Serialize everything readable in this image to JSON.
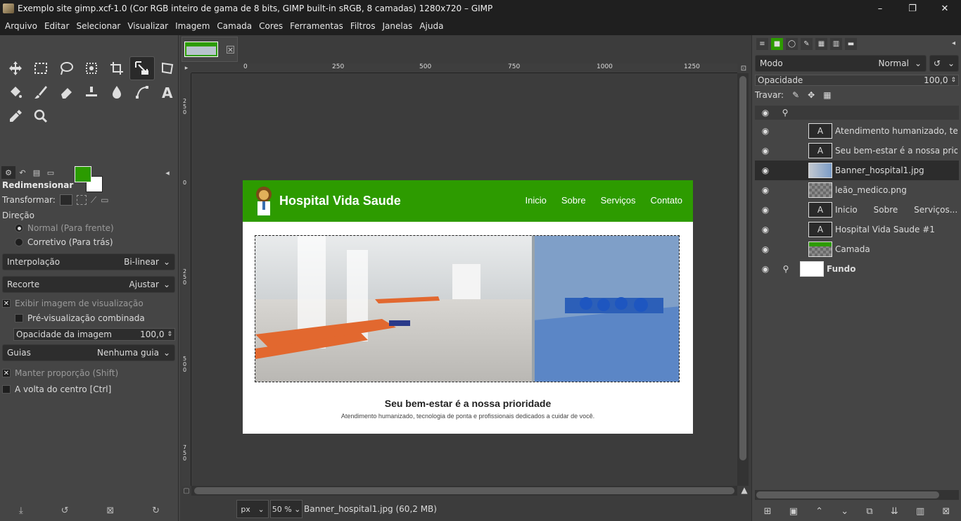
{
  "window": {
    "title": "Exemplo site gimp.xcf-1.0 (Cor RGB inteiro de gama de 8 bits, GIMP built-in sRGB, 8 camadas) 1280x720 – GIMP",
    "minimize": "–",
    "maximize": "❐",
    "close": "✕"
  },
  "menu": [
    "Arquivo",
    "Editar",
    "Selecionar",
    "Visualizar",
    "Imagem",
    "Camada",
    "Cores",
    "Ferramentas",
    "Filtros",
    "Janelas",
    "Ajuda"
  ],
  "colors": {
    "foreground": "#2b9b00",
    "background": "#ffffff",
    "accent_green": "#2d9b00"
  },
  "tool_options": {
    "title": "Redimensionar",
    "transform_label": "Transformar:",
    "direction_label": "Direção",
    "direction_normal": "Normal (Para frente)",
    "direction_corrective": "Corretivo (Para trás)",
    "interpolation_label": "Interpolação",
    "interpolation_value": "Bi-linear",
    "clipping_label": "Recorte",
    "clipping_value": "Ajustar",
    "show_preview": "Exibir imagem de visualização",
    "composited_preview": "Pré-visualização combinada",
    "image_opacity_label": "Opacidade da imagem",
    "image_opacity_value": "100,0",
    "guides_label": "Guias",
    "guides_value": "Nenhuma guia",
    "keep_aspect": "Manter proporção (Shift)",
    "around_center": "A volta do centro [Ctrl]"
  },
  "rulers": {
    "h_ticks": [
      "0",
      "250",
      "500",
      "750",
      "1000",
      "1250"
    ],
    "v_ticks": [
      "250",
      "0",
      "250",
      "500",
      "750"
    ]
  },
  "image": {
    "brand": "Hospital Vida Saude",
    "nav": [
      "Inicio",
      "Sobre",
      "Serviços",
      "Contato"
    ],
    "headline": "Seu bem-estar é a nossa prioridade",
    "subline": "Atendimento humanizado, tecnologia de ponta e profissionais dedicados a cuidar de você."
  },
  "status": {
    "unit": "px",
    "zoom": "50 %",
    "info": "Banner_hospital1.jpg (60,2 MB)"
  },
  "layers_panel": {
    "mode_label": "Modo",
    "mode_value": "Normal",
    "opacity_label": "Opacidade",
    "opacity_value": "100,0",
    "lock_label": "Travar:",
    "layers": [
      {
        "name": "Atendimento humanizado, tecr",
        "thumb": "text"
      },
      {
        "name": "Seu bem-estar é a nossa prior",
        "thumb": "text"
      },
      {
        "name": "Banner_hospital1.jpg",
        "thumb": "photo"
      },
      {
        "name": "leão_medico.png",
        "thumb": "check"
      },
      {
        "name": "Inicio      Sobre      Serviços...",
        "thumb": "text"
      },
      {
        "name": "Hospital Vida Saude #1",
        "thumb": "text"
      },
      {
        "name": "Camada",
        "thumb": "green"
      },
      {
        "name": "Fundo",
        "thumb": "white"
      }
    ]
  }
}
